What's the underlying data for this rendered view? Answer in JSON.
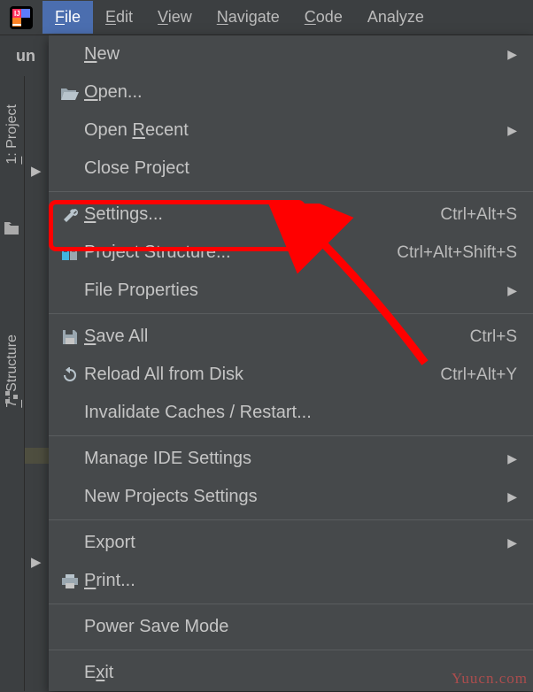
{
  "menubar": {
    "items": [
      {
        "label": "File",
        "mnemonic": "F"
      },
      {
        "label": "Edit",
        "mnemonic": "E"
      },
      {
        "label": "View",
        "mnemonic": "V"
      },
      {
        "label": "Navigate",
        "mnemonic": "N"
      },
      {
        "label": "Code",
        "mnemonic": "C"
      },
      {
        "label": "Analyze",
        "mnemonic": "A"
      }
    ]
  },
  "toolbar": {
    "project_label": "un"
  },
  "sidebar": {
    "tabs": [
      {
        "label": "1: Project",
        "mnemonic": "1"
      },
      {
        "label": "7: Structure",
        "mnemonic": "7"
      }
    ]
  },
  "menu": {
    "items": [
      {
        "label": "New",
        "mnemonic": "N",
        "submenu": true
      },
      {
        "label": "Open...",
        "mnemonic": "O",
        "icon": "folder-open"
      },
      {
        "label": "Open Recent",
        "mnemonic": "R",
        "submenu": true,
        "rest": "Open "
      },
      {
        "label": "Close Project"
      },
      {
        "label": "Settings...",
        "mnemonic": "S",
        "shortcut": "Ctrl+Alt+S",
        "icon": "wrench"
      },
      {
        "label": "Project Structure...",
        "shortcut": "Ctrl+Alt+Shift+S",
        "icon": "project-structure"
      },
      {
        "label": "File Properties",
        "submenu": true
      },
      {
        "label": "Save All",
        "mnemonic": "S",
        "shortcut": "Ctrl+S",
        "icon": "save"
      },
      {
        "label": "Reload All from Disk",
        "shortcut": "Ctrl+Alt+Y",
        "icon": "reload"
      },
      {
        "label": "Invalidate Caches / Restart..."
      },
      {
        "label": "Manage IDE Settings",
        "submenu": true
      },
      {
        "label": "New Projects Settings",
        "submenu": true
      },
      {
        "label": "Export",
        "submenu": true
      },
      {
        "label": "Print...",
        "mnemonic": "P",
        "icon": "print"
      },
      {
        "label": "Power Save Mode"
      },
      {
        "label": "Exit",
        "mnemonic": "x",
        "rest": "E"
      }
    ]
  },
  "watermark": "Yuucn.com"
}
